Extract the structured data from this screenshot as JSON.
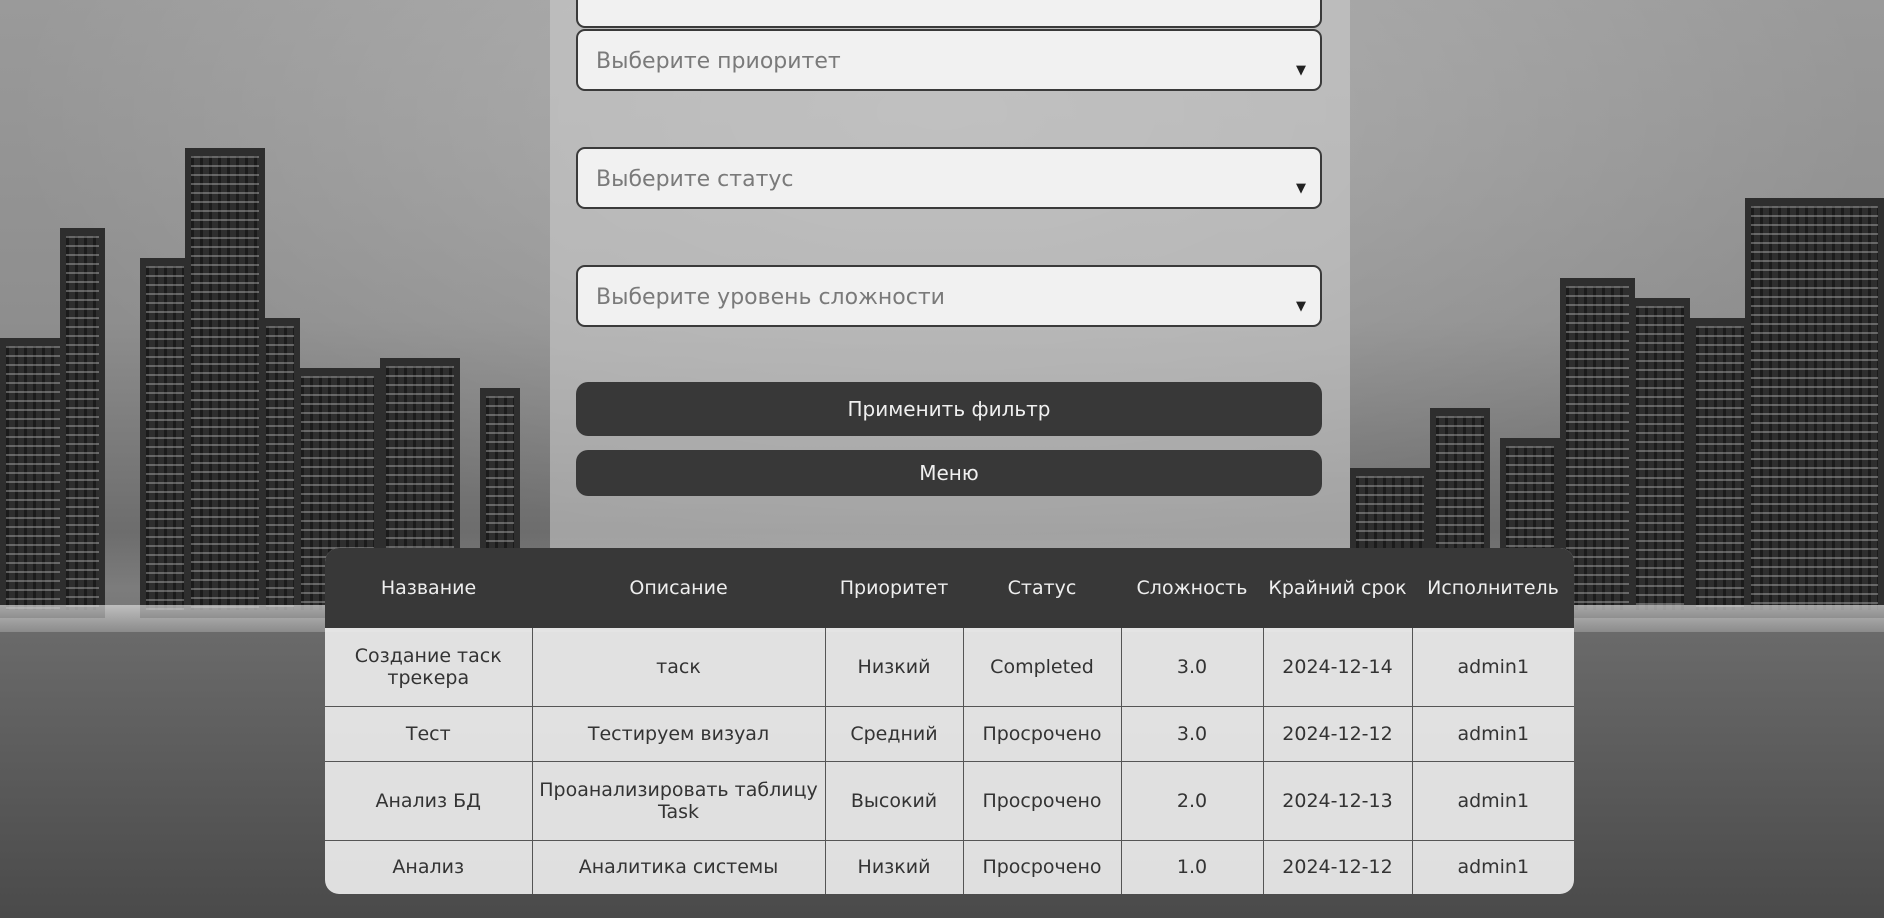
{
  "filters": {
    "priority_placeholder": "Выберите приоритет",
    "status_placeholder": "Выберите статус",
    "difficulty_placeholder": "Выберите уровень сложности",
    "dropdown_icon": "chevron-down-icon"
  },
  "buttons": {
    "apply": "Применить фильтр",
    "menu": "Меню"
  },
  "table": {
    "headers": {
      "name": "Название",
      "description": "Описание",
      "priority": "Приоритет",
      "status": "Статус",
      "difficulty": "Сложность",
      "deadline": "Крайний срок",
      "assignee": "Исполнитель"
    },
    "rows": [
      {
        "name": "Создание таск трекера",
        "description": "таск",
        "priority": "Низкий",
        "status": "Completed",
        "difficulty": "3.0",
        "deadline": "2024-12-14",
        "assignee": "admin1"
      },
      {
        "name": "Тест",
        "description": "Тестируем визуал",
        "priority": "Средний",
        "status": "Просрочено",
        "difficulty": "3.0",
        "deadline": "2024-12-12",
        "assignee": "admin1"
      },
      {
        "name": "Анализ БД",
        "description": "Проанализировать таблицу Task",
        "priority": "Высокий",
        "status": "Просрочено",
        "difficulty": "2.0",
        "deadline": "2024-12-13",
        "assignee": "admin1"
      },
      {
        "name": "Анализ",
        "description": "Аналитика системы",
        "priority": "Низкий",
        "status": "Просрочено",
        "difficulty": "1.0",
        "deadline": "2024-12-12",
        "assignee": "admin1"
      }
    ]
  },
  "colors": {
    "button_bg": "#383838",
    "header_bg": "#383838",
    "select_bg": "#f1f1f1"
  }
}
